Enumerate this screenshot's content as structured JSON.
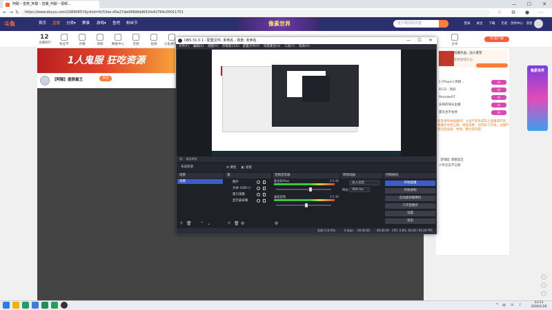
{
  "browser": {
    "tab_title": "阿聪丶皇族_阿聪丶直播_阿聪丶视频...",
    "url": "https://www.douyu.com/10890657dyshid=0c53ee-d0a27abd99b8dd652fe42764c00011701",
    "win_controls": [
      "—",
      "☐",
      "✕"
    ]
  },
  "douyu": {
    "logo": "斗鱼",
    "nav": [
      "首页",
      "直播",
      "分类▾",
      "赛事",
      "游戏▾",
      "鱼吧",
      "粉丝节"
    ],
    "banner": "像素世界",
    "search_placeholder": "这个网页好厉害",
    "header_right": [
      "登录",
      "关注",
      "下载",
      "历史",
      "创作中心",
      "消息"
    ],
    "sub_nav": [
      {
        "label": "主播排行"
      },
      {
        "label": "粉丝节"
      },
      {
        "label": "开播"
      },
      {
        "label": "周榜"
      },
      {
        "label": "数据中心"
      },
      {
        "label": "音频"
      },
      {
        "label": "鱼塘"
      },
      {
        "label": "斗鱼通行证"
      },
      {
        "label": "分享"
      }
    ],
    "follow_count": "12",
    "ad_text": "1人鬼服 狂吃资源",
    "streamer_name": "【阿聪】盘狼鼠王",
    "follow_label": "关注",
    "pc_badge": "PC客户端",
    "promo_title": "招募热血，战斗重塑",
    "promo_sub": "使用游戏礼包",
    "rank_rows": [
      "1 [Player] 周榜...",
      "8112 · 饱抖",
      "Remake07",
      "乐购的快乐主播",
      "夏天也不会停"
    ],
    "chat_text": "欢迎来到本直播间！斗鱼严禁未成年人直播或打赏，请遵守文明上网，理性消费，切勿私下交易。主播严禁涉及低俗、色情、暴力等内容。",
    "chat_lines": [
      "【阿聪】盘狼鼠王",
      "少年壮志不言愁"
    ],
    "side_ad": "像素世界"
  },
  "obs": {
    "title": "OBS 31.0.1 - 配置文件: 未命名 - 场景: 未命名",
    "menu": [
      "文件(F)",
      "编辑(E)",
      "视图(V)",
      "停靠窗口(D)",
      "配置文件(P)",
      "场景集合(S)",
      "工具(T)",
      "帮助(H)"
    ],
    "scene_bar": "源：  请选择源",
    "no_source": "未选择源",
    "props_label": "⚙ 属性",
    "filters_label": "◧ 滤镜",
    "docks": {
      "scenes": "场景",
      "sources": "源",
      "mixer": "音频混音器",
      "transitions": "转场动画",
      "controls": "控制按钮"
    },
    "scene_items": [
      "场景"
    ],
    "sources": [
      "图片",
      "文本 (GDI+)",
      "窗口采集",
      "显示器采集"
    ],
    "mixer": [
      {
        "name": "麦克风/Aux",
        "db": "0.0 dB",
        "level": 0.62
      },
      {
        "name": "桌面音频",
        "db": "0.0 dB",
        "level": 0.55
      }
    ],
    "transition": {
      "type": "淡入淡出",
      "duration_label": "时长",
      "duration": "300 ms"
    },
    "controls": [
      "开始直播",
      "开始录制",
      "启动虚拟摄像机",
      "工作室模式",
      "设置",
      "退出"
    ],
    "status": {
      "frames": "丢帧 0 (0.0%)",
      "bitrate": "0 kbps",
      "stream_time": "00:00:00",
      "rec_time": "00:00:00",
      "cpu": "CPU: 0.8%, 60.00 / 60.00 FPS"
    }
  },
  "taskbar": {
    "time": "13:11",
    "date": "2026/1/26",
    "tray": [
      "^",
      "中",
      "⊙",
      "♪"
    ]
  },
  "colors": {
    "douyu_orange": "#ff7d3a",
    "douyu_header": "#2a2f6e",
    "obs_accent": "#3b5dc9",
    "obs_bg": "#1f2128"
  }
}
